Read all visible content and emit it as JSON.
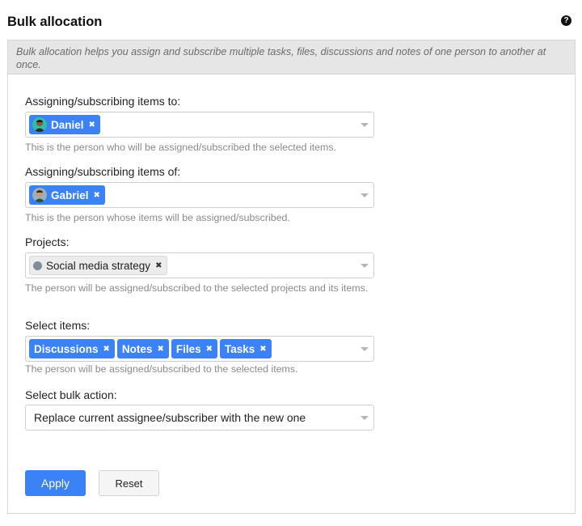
{
  "header": {
    "title": "Bulk allocation",
    "help_icon": "question-circle-icon"
  },
  "info": {
    "text": "Bulk allocation helps you assign and subscribe multiple tasks, files, discussions and notes of one person to another at once."
  },
  "fields": {
    "assign_to": {
      "label": "Assigning/subscribing items to:",
      "chips": [
        {
          "label": "Daniel",
          "icon": "avatar-daniel"
        }
      ],
      "help": "This is the person who will be assigned/subscribed the selected items."
    },
    "assign_of": {
      "label": "Assigning/subscribing items of:",
      "chips": [
        {
          "label": "Gabriel",
          "icon": "avatar-gabriel"
        }
      ],
      "help": "This is the person whose items will be assigned/subscribed."
    },
    "projects": {
      "label": "Projects:",
      "chips": [
        {
          "label": "Social media strategy",
          "dot_color": "#7f8c99"
        }
      ],
      "help": "The person will be assigned/subscribed to the selected projects and its items."
    },
    "items": {
      "label": "Select items:",
      "chips": [
        {
          "label": "Discussions"
        },
        {
          "label": "Notes"
        },
        {
          "label": "Files"
        },
        {
          "label": "Tasks"
        }
      ],
      "help": "The person will be assigned/subscribed to the selected items."
    },
    "bulk_action": {
      "label": "Select bulk action:",
      "value": "Replace current assignee/subscriber with the new one"
    }
  },
  "buttons": {
    "apply": "Apply",
    "reset": "Reset"
  },
  "colors": {
    "accent": "#3b82f6",
    "banner_bg": "#e6e6e6"
  }
}
